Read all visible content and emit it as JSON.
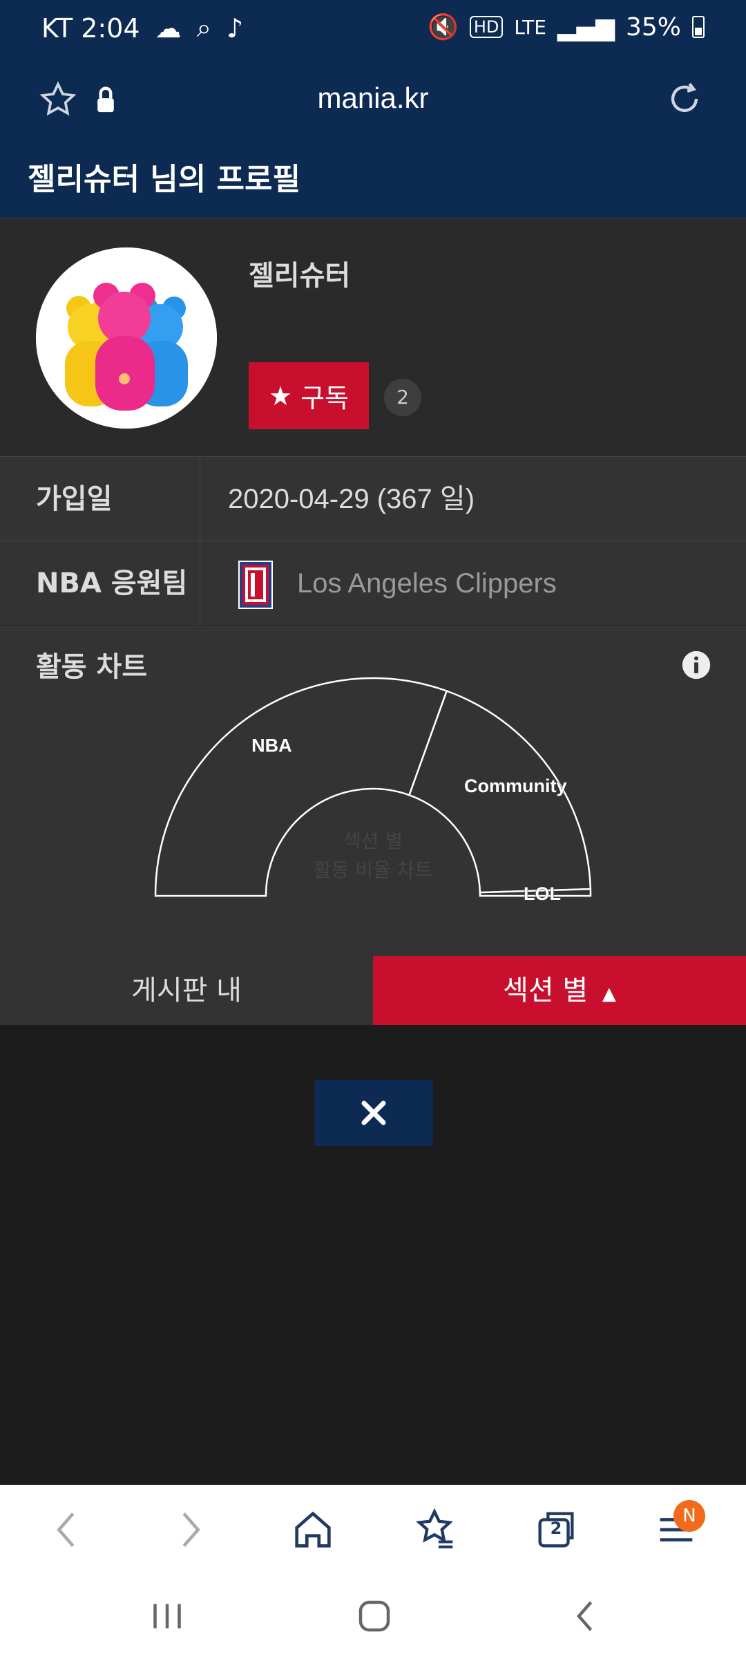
{
  "status_bar": {
    "carrier_time": "KT 2:04",
    "network": "LTE",
    "battery": "35%"
  },
  "browser": {
    "url": "mania.kr",
    "tab_count": "2",
    "menu_badge": "N"
  },
  "page": {
    "title": "젤리슈터 님의 프로필"
  },
  "profile": {
    "nickname": "젤리슈터",
    "subscribe_label": "구독",
    "subscriber_count": "2"
  },
  "info": {
    "join_label": "가입일",
    "join_value": "2020-04-29 (367 일)",
    "team_label": "NBA 응원팀",
    "team_value": "Los Angeles Clippers"
  },
  "activity": {
    "title": "활동 차트",
    "center_text_line1": "섹션 별",
    "center_text_line2": "활동 비율 차트"
  },
  "chart_data": {
    "type": "pie",
    "subtype": "semi-donut",
    "categories": [
      "NBA",
      "Community",
      "LOL"
    ],
    "values": [
      61,
      38,
      1
    ]
  },
  "tabs": {
    "board": "게시판 내",
    "section": "섹션 별"
  },
  "colors": {
    "header_bg": "#0d2a52",
    "accent_red": "#c8102e",
    "page_bg": "#1c1c1c",
    "panel_bg": "#333333"
  }
}
